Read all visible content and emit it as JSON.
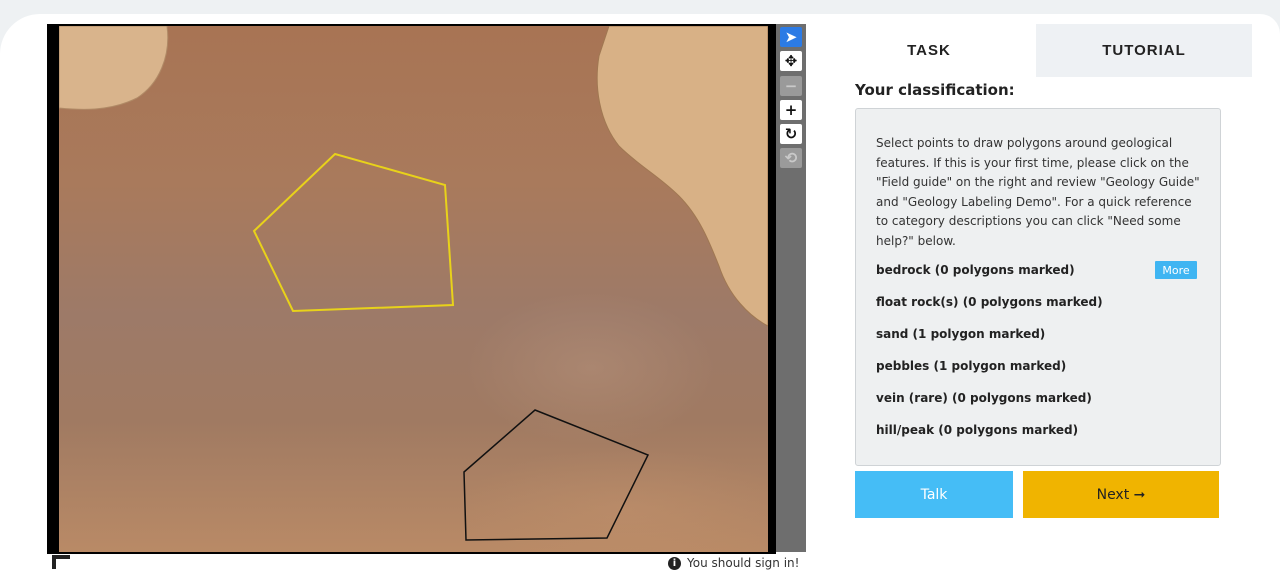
{
  "toolbar": {
    "tools": [
      {
        "icon": "cursor-icon",
        "glyph": "➤"
      },
      {
        "icon": "move-icon",
        "glyph": "✥"
      },
      {
        "icon": "zoom-out-icon",
        "glyph": "−"
      },
      {
        "icon": "zoom-in-icon",
        "glyph": "+"
      },
      {
        "icon": "rotate-icon",
        "glyph": "↻"
      },
      {
        "icon": "reset-icon",
        "glyph": "⟲"
      }
    ]
  },
  "status": {
    "signin_text": "You should sign in!",
    "info_glyph": "i"
  },
  "panel": {
    "tabs": [
      {
        "label": "TASK",
        "active": true
      },
      {
        "label": "TUTORIAL",
        "active": false
      }
    ],
    "classification_title": "Your classification:",
    "instructions": "Select points to draw polygons around geological features. If this is your first time, please click on the \"Field guide\" on the right and review \"Geology Guide\" and \"Geology Labeling Demo\". For a quick reference to category descriptions you can click \"Need some help?\" below.",
    "choices": [
      "bedrock (0 polygons marked)",
      "float rock(s) (0 polygons marked)",
      "sand (1 polygon marked)",
      "pebbles (1 polygon marked)",
      "vein (rare) (0 polygons marked)",
      "hill/peak (0 polygons marked)"
    ],
    "more_label": "More",
    "talk_label": "Talk",
    "next_label": "Next ➞"
  },
  "colors": {
    "accent_blue": "#45bdf6",
    "next_yellow": "#f0b400",
    "sand_polygon": "#e8d21a",
    "pebbles_polygon": "#111111"
  }
}
